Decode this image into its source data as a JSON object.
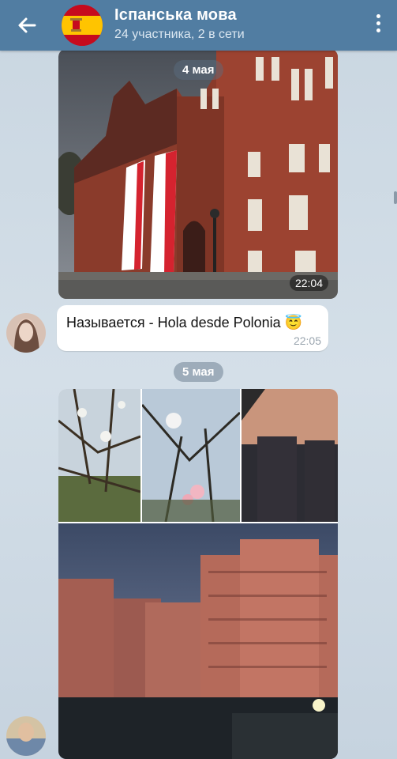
{
  "header": {
    "title": "Іспанська мова",
    "subtitle": "24 участника, 2 в сети"
  },
  "messages": {
    "date1": "4 мая",
    "photo1_time": "22:04",
    "text_message": "Называется - Hola desde Polonia 😇",
    "text_time": "22:05",
    "date2": "5 мая"
  },
  "icons": {
    "back": "arrow-left-icon",
    "menu": "more-vertical-icon",
    "chat_avatar": "spain-flag"
  },
  "colors": {
    "header": "#517da2",
    "bubble": "#ffffff",
    "accent": "#5b89b1"
  }
}
